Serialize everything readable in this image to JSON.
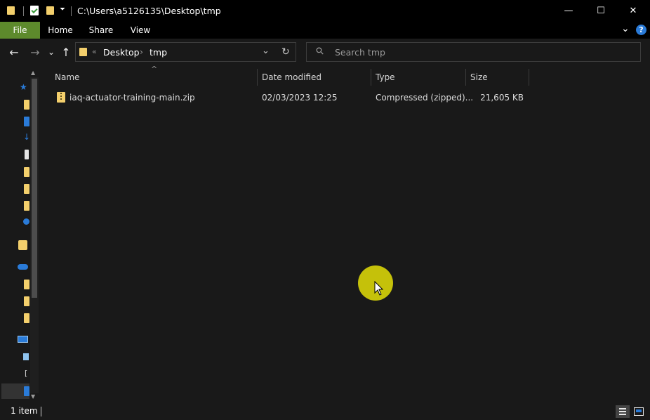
{
  "window": {
    "title": "C:\\Users\\a5126135\\Desktop\\tmp",
    "minimize_glyph": "—",
    "maximize_glyph": "☐",
    "close_glyph": "✕"
  },
  "qat": {
    "dropdown_glyph": "⏷"
  },
  "ribbon": {
    "tabs": [
      "File",
      "Home",
      "Share",
      "View"
    ],
    "expand_glyph": "⌄",
    "help_glyph": "?",
    "accent": "#5d8a2c"
  },
  "nav": {
    "back_glyph": "←",
    "forward_glyph": "→",
    "recent_glyph": "⌄",
    "up_glyph": "↑"
  },
  "address": {
    "overflow_glyph": "«",
    "crumbs": [
      "Desktop",
      "tmp"
    ],
    "separator": "›",
    "dropdown_glyph": "⌄",
    "refresh_glyph": "↻"
  },
  "search": {
    "placeholder": "Search tmp",
    "icon_glyph": "⚲"
  },
  "columns": {
    "name": "Name",
    "date_modified": "Date modified",
    "type": "Type",
    "size": "Size",
    "sort_glyph": "^"
  },
  "files": [
    {
      "name": "iaq-actuator-training-main.zip",
      "date_modified": "02/03/2023 12:25",
      "type": "Compressed (zipped)...",
      "size": "21,605 KB",
      "icon": "zip-folder-icon"
    }
  ],
  "status": {
    "item_count": "1 item"
  },
  "colors": {
    "folder_yellow": "#f3cf6c",
    "blue": "#2a7bd8",
    "cursor_highlight": "#c5c10a"
  }
}
